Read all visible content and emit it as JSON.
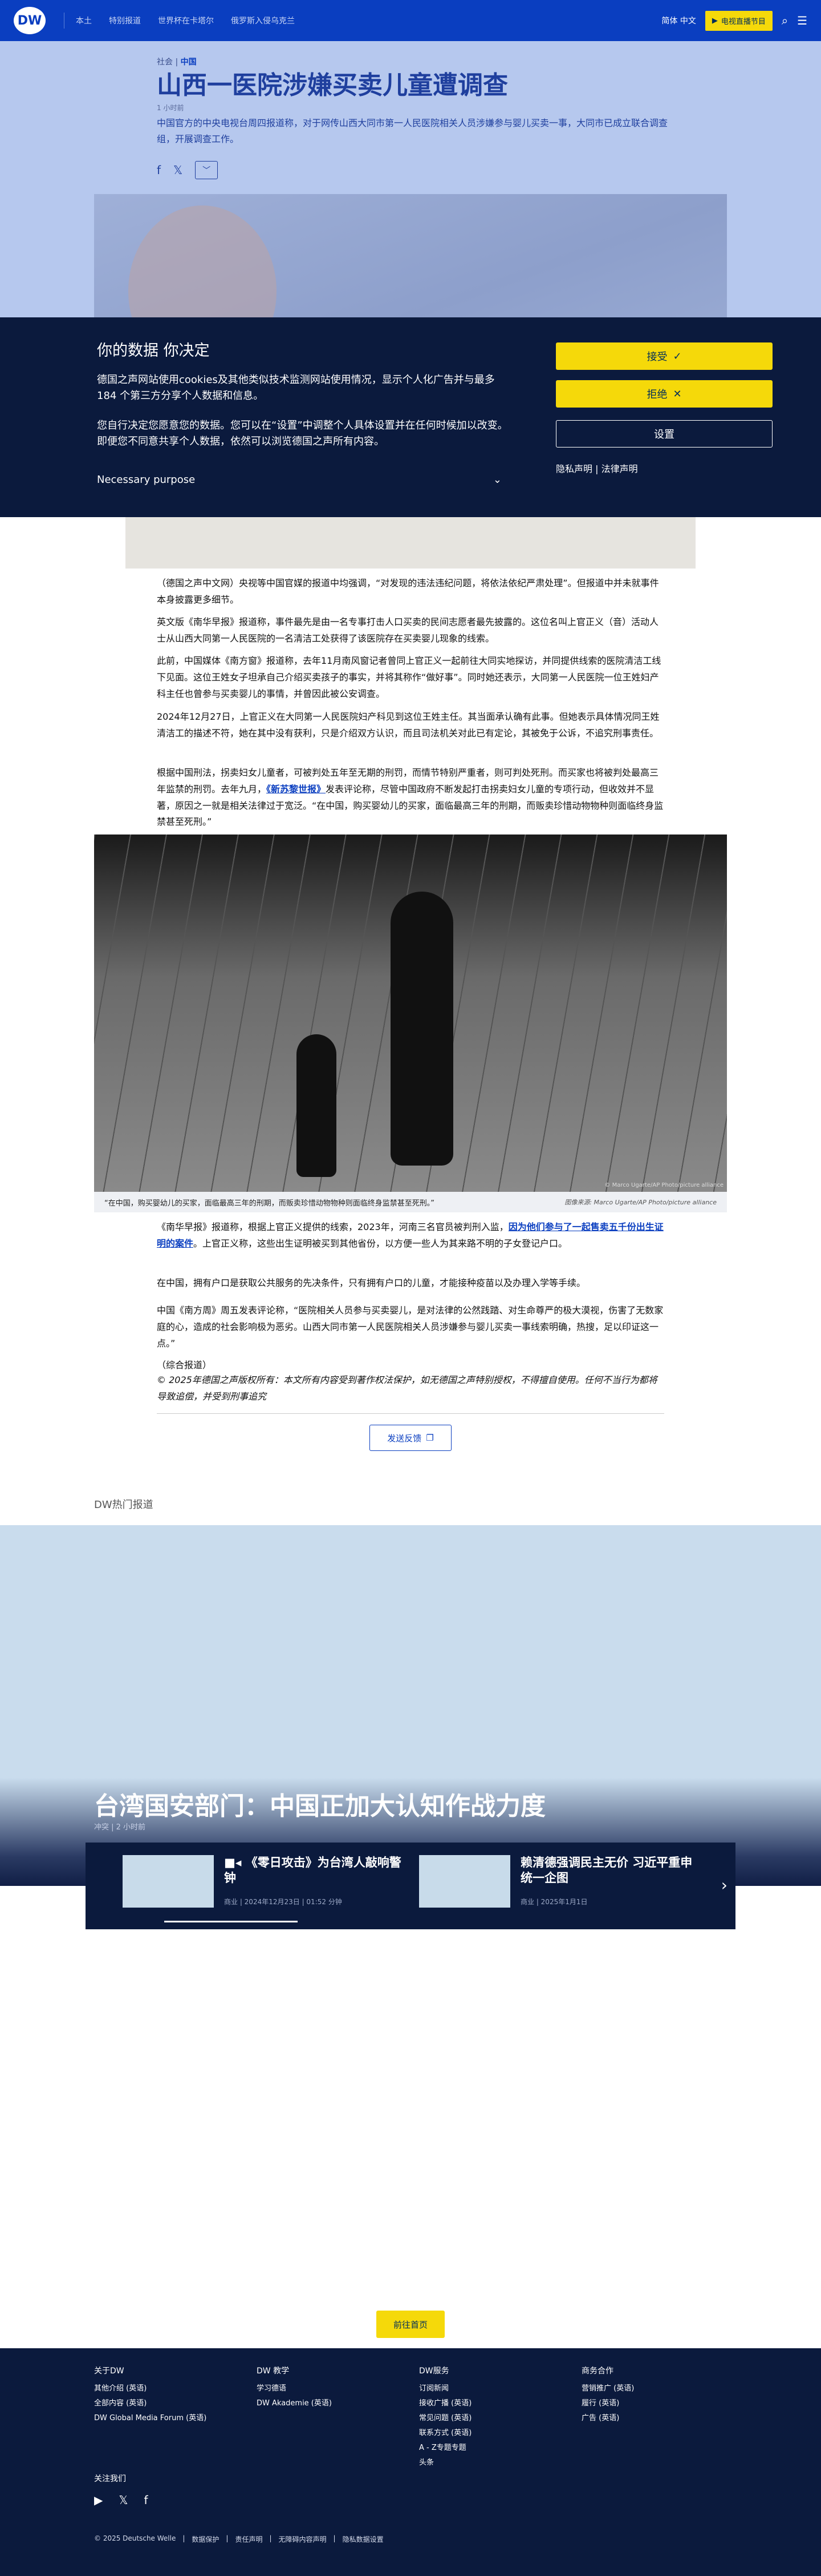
{
  "header": {
    "logo": "DW",
    "nav": [
      "本土",
      "特别报道",
      "世界杯在卡塔尔",
      "俄罗斯入侵乌克兰"
    ],
    "lang": "简体 中文",
    "live": "电视直播节目",
    "icons": [
      "radio-icon",
      "search-icon",
      "menu-icon"
    ]
  },
  "article": {
    "section": "社会",
    "region": "中国",
    "title": "山西一医院涉嫌买卖儿童遭调查",
    "time": "1 小时前",
    "teaser": "中国官方的中央电视台周四报道称，对于网传山西大同市第一人民医院相关人员涉嫌参与婴儿买卖一事，大同市已成立联合调查组，开展调查工作。",
    "share_more": "﹀"
  },
  "cookie": {
    "title": "你的数据 你决定",
    "p1": "德国之声网站使用cookies及其他类似技术监测网站使用情况，显示个人化广告并与最多184 个第三方分享个人数据和信息。",
    "p2": "您自行决定您愿意您的数据。您可以在“设置”中调整个人具体设置并在任何时候加以改变。即便您不同意共享个人数据，依然可以浏览德国之声所有内容。",
    "purpose": "Necessary purpose",
    "accept": "接受",
    "reject": "拒绝",
    "settings": "设置",
    "privacy": "隐私声明",
    "legal": "法律声明"
  },
  "body": {
    "p1": "（德国之声中文网）央视等中国官媒的报道中均强调，“对发现的违法违纪问题，将依法依纪严肃处理”。但报道中并未就事件本身披露更多细节。",
    "p2": "英文版《南华早报》报道称，事件最先是由一名专事打击人口买卖的民间志愿者最先披露的。这位名叫上官正义（音）活动人士从山西大同第一人民医院的一名清洁工处获得了该医院存在买卖婴儿现象的线索。",
    "p3": "此前，中国媒体《南方窗》报道称，去年11月南风窗记者曾同上官正义一起前往大同实地探访，并同提供线索的医院清洁工线下见面。这位王姓女子坦承自己介绍买卖孩子的事实，并将其称作“做好事”。同时她还表示，大同第一人民医院一位王姓妇产科主任也曾参与买卖婴儿的事情，并曾因此被公安调查。",
    "p4": "2024年12月27日，上官正义在大同第一人民医院妇产科见到这位王姓主任。其当面承认确有此事。但她表示具体情况同王姓清洁工的描述不符，她在其中没有获利，只是介绍双方认识，而且司法机关对此已有定论，其被免于公诉，不追究刑事责任。",
    "p5": "根据中国刑法，拐卖妇女儿童者，可被判处五年至无期的刑罚，而情节特别严重者，则可判处死刑。而买家也将被判处最高三年监禁的刑罚。去年九月，",
    "p5_link": "《新苏黎世报》",
    "p5_rest": "发表评论称，尽管中国政府不断发起打击拐卖妇女儿童的专项行动，但收效并不显著，原因之一就是相关法律过于宽泛。“在中国，购买婴幼儿的买家，面临最高三年的刑期，而贩卖珍惜动物物种则面临终身监禁甚至死刑。”",
    "caption": "“在中国，购买婴幼儿的买家，面临最高三年的刑期，而贩卖珍惜动物物种则面临终身监禁甚至死刑。”",
    "credit": "图像来源: Marco Ugarte/AP Photo/picture alliance",
    "credit_in": "© Marco Ugarte/AP Photo/picture alliance",
    "p6_a": "《南华早报》报道称，根据上官正义提供的线索，2023年，河南三名官员被判刑入监，",
    "p6_link": "因为他们参与了一起售卖五千份出生证明的案件",
    "p6_b": "。上官正义称，这些出生证明被买到其他省份，以方便一些人为其来路不明的子女登记户口。",
    "p7": "在中国，拥有户口是获取公共服务的先决条件，只有拥有户口的儿童，才能接种疫苗以及办理入学等手续。",
    "p8": "中国《南方周》周五发表评论称，“医院相关人员参与买卖婴儿，是对法律的公然践踏、对生命尊严的极大漠视，伤害了无数家庭的心，造成的社会影响极为恶劣。山西大同市第一人民医院相关人员涉嫌参与婴儿买卖一事线索明确，热搜，足以印证这一点。”",
    "source": "（综合报道）",
    "copyright": "© 2025年德国之声版权所有：本文所有内容受到著作权法保护，如无德国之声特别授权，不得擅自使用。任何不当行为都将导致追偿，并受到刑事追究",
    "feedback": "发送反馈"
  },
  "recommended": {
    "heading": "DW热门报道",
    "hero_title": "台湾国安部门：中国正加大认知作战力度",
    "hero_meta": "冲突 | 2 小时前",
    "cards": [
      {
        "title": "《零日攻击》为台湾人敲响警钟",
        "meta": "商业 | 2024年12月23日 | 01:52 分钟",
        "icon": "video-icon"
      },
      {
        "title": "赖清德强调民主无价 习近平重申统一企图",
        "meta": "商业 | 2025年1月1日",
        "icon": ""
      }
    ]
  },
  "back_to_top": "前往首页",
  "footer": {
    "cols": [
      {
        "title": "关于DW",
        "items": [
          "其他介绍 (英语)",
          "全部内容 (英语)",
          "DW Global Media Forum (英语)"
        ]
      },
      {
        "title": "DW 教学",
        "items": [
          "学习德语",
          "DW Akademie (英语)"
        ]
      },
      {
        "title": "DW服务",
        "items": [
          "订阅新闻",
          "接收广播 (英语)",
          "常见问题 (英语)",
          "联系方式 (英语)",
          "A - Z专题专题",
          "头条"
        ]
      },
      {
        "title": "商务合作",
        "items": [
          "营销推广 (英语)",
          "履行 (英语)",
          "广告 (英语)"
        ]
      }
    ],
    "follow": "关注我们",
    "bottom": [
      "© 2025 Deutsche Welle",
      "数据保护",
      "责任声明",
      "无障碍内容声明",
      "隐私数据设置"
    ]
  }
}
